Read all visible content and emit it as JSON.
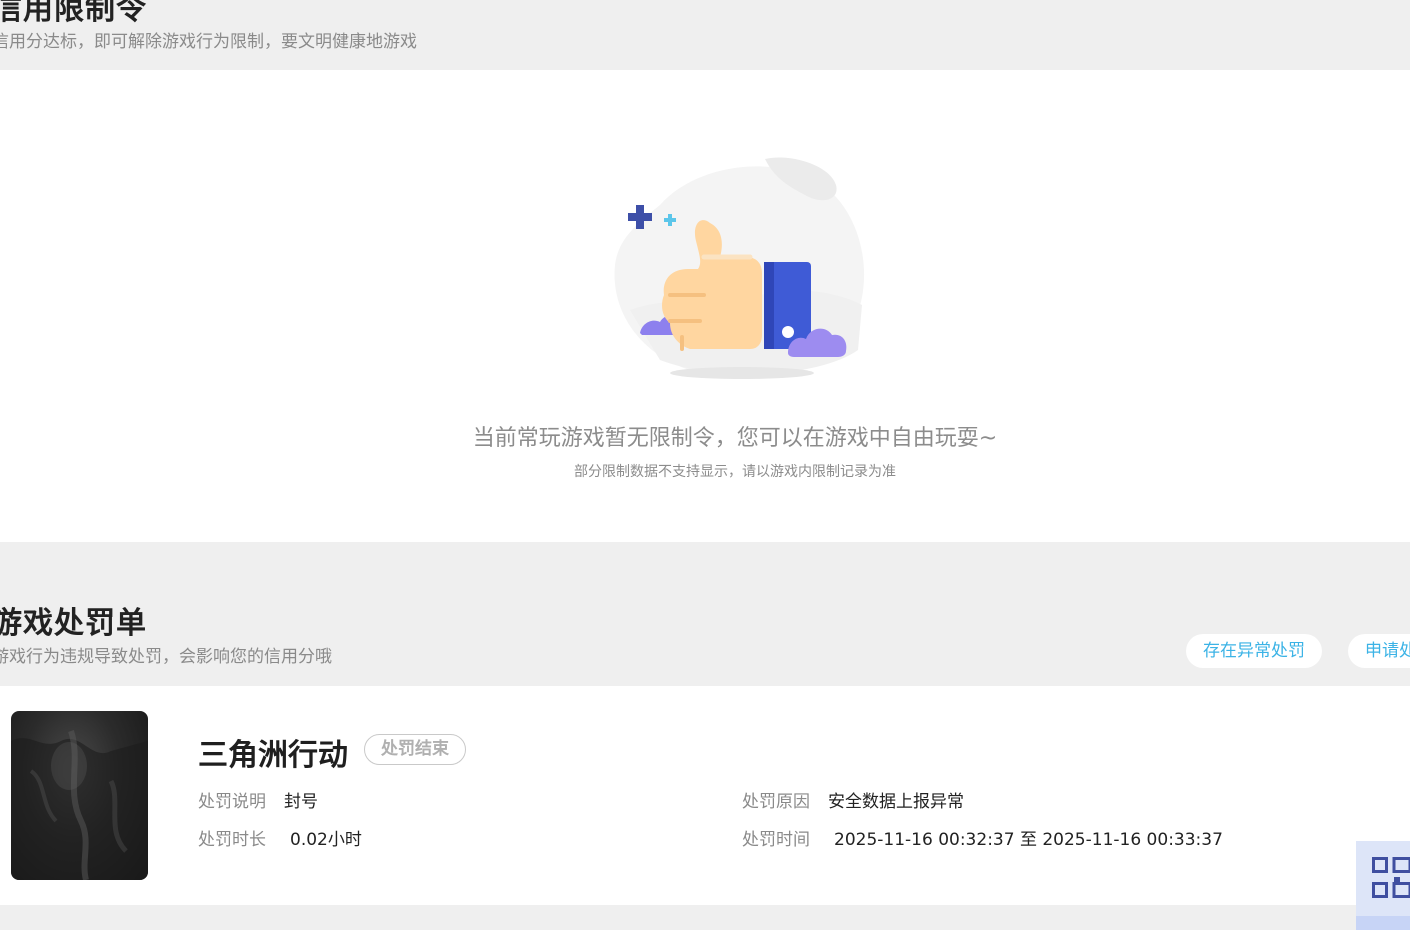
{
  "restriction_section": {
    "title": "信用限制令",
    "subtitle": "信用分达标，即可解除游戏行为限制，要文明健康地游戏"
  },
  "empty_state": {
    "message": "当前常玩游戏暂无限制令，您可以在游戏中自由玩耍~",
    "note": "部分限制数据不支持显示，请以游戏内限制记录为准",
    "illustration_icon": "thumbs-up-illustration"
  },
  "penalty_section": {
    "title": "游戏处罚单",
    "subtitle": "游戏行为违规导致处罚，会影响您的信用分哦",
    "actions": [
      "存在异常处罚",
      "申请处罚"
    ]
  },
  "penalty_card": {
    "game_name": "三角洲行动",
    "status": "处罚结束",
    "fields": {
      "desc_label": "处罚说明",
      "desc_value": "封号",
      "duration_label": "处罚时长",
      "duration_value": "0.02小时",
      "reason_label": "处罚原因",
      "reason_value": "安全数据上报异常",
      "time_label": "处罚时间",
      "time_value": "2025-11-16 00:32:37 至 2025-11-16 00:33:37"
    }
  },
  "side_widget": {
    "icon": "qr-code-icon"
  },
  "colors": {
    "page_bg": "#efefef",
    "accent_cyan": "#3bb3e6",
    "thumb_skin": "#ffd6a0",
    "cuff_blue": "#3f5bd6",
    "cloud_purple": "#9d8cf0",
    "sparkle_navy": "#3d4fa8",
    "sparkle_cyan": "#5cc6ea"
  }
}
